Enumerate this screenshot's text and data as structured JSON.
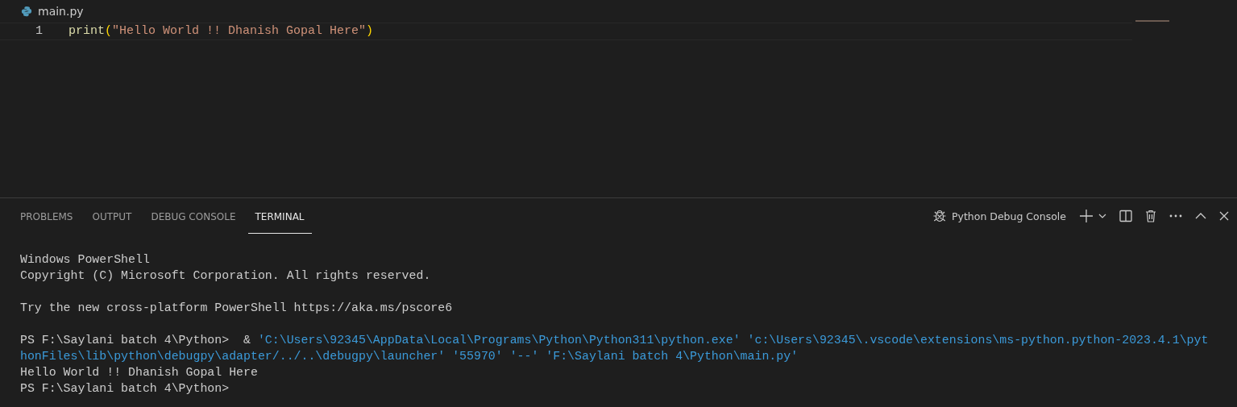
{
  "editor": {
    "file_tab": {
      "label": "main.py"
    },
    "lines": [
      {
        "number": "1",
        "tokens": [
          {
            "kind": "function",
            "text": "print"
          },
          {
            "kind": "bracket",
            "text": "("
          },
          {
            "kind": "string",
            "text": "\"Hello World !! Dhanish Gopal Here\""
          },
          {
            "kind": "bracket",
            "text": ")"
          }
        ]
      }
    ]
  },
  "panel": {
    "tabs": [
      {
        "label": "PROBLEMS",
        "selected": false
      },
      {
        "label": "OUTPUT",
        "selected": false
      },
      {
        "label": "DEBUG CONSOLE",
        "selected": false
      },
      {
        "label": "TERMINAL",
        "selected": true
      }
    ],
    "terminal_selector": {
      "label": "Python Debug Console"
    },
    "terminal": [
      {
        "lines": [
          {
            "segments": [
              {
                "kind": "plain",
                "text": "Windows PowerShell"
              }
            ]
          },
          {
            "segments": [
              {
                "kind": "plain",
                "text": "Copyright (C) Microsoft Corporation. All rights reserved."
              }
            ]
          }
        ]
      },
      {
        "lines": [
          {
            "segments": [
              {
                "kind": "plain",
                "text": "Try the new cross-platform PowerShell https://aka.ms/pscore6"
              }
            ]
          }
        ]
      },
      {
        "lines": [
          {
            "segments": [
              {
                "kind": "plain",
                "text": "PS F:\\Saylani batch 4\\Python>  & "
              },
              {
                "kind": "arg",
                "text": "'C:\\Users\\92345\\AppData\\Local\\Programs\\Python\\Python311\\python.exe' 'c:\\Users\\92345\\.vscode\\extensions\\ms-python.python-2023.4.1\\pyt"
              }
            ]
          },
          {
            "segments": [
              {
                "kind": "arg",
                "text": "honFiles\\lib\\python\\debugpy\\adapter/../..\\debugpy\\launcher' '55970' '--' 'F:\\Saylani batch 4\\Python\\main.py'"
              }
            ]
          },
          {
            "segments": [
              {
                "kind": "plain",
                "text": "Hello World !! Dhanish Gopal Here"
              }
            ]
          },
          {
            "segments": [
              {
                "kind": "plain",
                "text": "PS F:\\Saylani batch 4\\Python>"
              }
            ]
          }
        ]
      }
    ]
  }
}
